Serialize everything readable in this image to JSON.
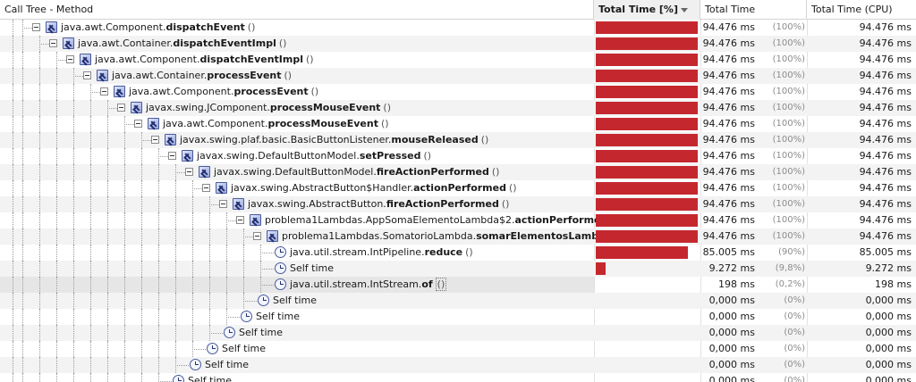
{
  "header": {
    "method": "Call Tree - Method",
    "total_time_pct": "Total Time [%]",
    "total_time": "Total Time",
    "total_time_cpu": "Total Time (CPU)"
  },
  "rows": [
    {
      "depth": 0,
      "kind": "method",
      "prefix": "java.awt.Component.",
      "name": "dispatchEvent",
      "paren": "()",
      "fraction": 1.0,
      "ms": "94.476 ms",
      "pct": "(100%)",
      "cpu": "94.476 ms"
    },
    {
      "depth": 1,
      "kind": "method",
      "prefix": "java.awt.Container.",
      "name": "dispatchEventImpl",
      "paren": "()",
      "fraction": 1.0,
      "ms": "94.476 ms",
      "pct": "(100%)",
      "cpu": "94.476 ms"
    },
    {
      "depth": 2,
      "kind": "method",
      "prefix": "java.awt.Component.",
      "name": "dispatchEventImpl",
      "paren": "()",
      "fraction": 1.0,
      "ms": "94.476 ms",
      "pct": "(100%)",
      "cpu": "94.476 ms"
    },
    {
      "depth": 3,
      "kind": "method",
      "prefix": "java.awt.Container.",
      "name": "processEvent",
      "paren": "()",
      "fraction": 1.0,
      "ms": "94.476 ms",
      "pct": "(100%)",
      "cpu": "94.476 ms"
    },
    {
      "depth": 4,
      "kind": "method",
      "prefix": "java.awt.Component.",
      "name": "processEvent",
      "paren": "()",
      "fraction": 1.0,
      "ms": "94.476 ms",
      "pct": "(100%)",
      "cpu": "94.476 ms"
    },
    {
      "depth": 5,
      "kind": "method",
      "prefix": "javax.swing.JComponent.",
      "name": "processMouseEvent",
      "paren": "()",
      "fraction": 1.0,
      "ms": "94.476 ms",
      "pct": "(100%)",
      "cpu": "94.476 ms"
    },
    {
      "depth": 6,
      "kind": "method",
      "prefix": "java.awt.Component.",
      "name": "processMouseEvent",
      "paren": "()",
      "fraction": 1.0,
      "ms": "94.476 ms",
      "pct": "(100%)",
      "cpu": "94.476 ms"
    },
    {
      "depth": 7,
      "kind": "method",
      "prefix": "javax.swing.plaf.basic.BasicButtonListener.",
      "name": "mouseReleased",
      "paren": "()",
      "fraction": 1.0,
      "ms": "94.476 ms",
      "pct": "(100%)",
      "cpu": "94.476 ms"
    },
    {
      "depth": 8,
      "kind": "method",
      "prefix": "javax.swing.DefaultButtonModel.",
      "name": "setPressed",
      "paren": "()",
      "fraction": 1.0,
      "ms": "94.476 ms",
      "pct": "(100%)",
      "cpu": "94.476 ms"
    },
    {
      "depth": 9,
      "kind": "method",
      "prefix": "javax.swing.DefaultButtonModel.",
      "name": "fireActionPerformed",
      "paren": "()",
      "fraction": 1.0,
      "ms": "94.476 ms",
      "pct": "(100%)",
      "cpu": "94.476 ms"
    },
    {
      "depth": 10,
      "kind": "method",
      "prefix": "javax.swing.AbstractButton$Handler.",
      "name": "actionPerformed",
      "paren": "()",
      "fraction": 1.0,
      "ms": "94.476 ms",
      "pct": "(100%)",
      "cpu": "94.476 ms"
    },
    {
      "depth": 11,
      "kind": "method",
      "prefix": "javax.swing.AbstractButton.",
      "name": "fireActionPerformed",
      "paren": "()",
      "fraction": 1.0,
      "ms": "94.476 ms",
      "pct": "(100%)",
      "cpu": "94.476 ms"
    },
    {
      "depth": 12,
      "kind": "method",
      "prefix": "problema1Lambdas.AppSomaElementoLambda$2.",
      "name": "actionPerformed",
      "paren": "()",
      "fraction": 1.0,
      "ms": "94.476 ms",
      "pct": "(100%)",
      "cpu": "94.476 ms"
    },
    {
      "depth": 13,
      "kind": "method",
      "prefix": "problema1Lambdas.SomatorioLambda.",
      "name": "somarElementosLambdas",
      "paren": "()",
      "fraction": 1.0,
      "ms": "94.476 ms",
      "pct": "(100%)",
      "cpu": "94.476 ms"
    },
    {
      "depth": 14,
      "kind": "clock",
      "prefix": "java.util.stream.IntPipeline.",
      "name": "reduce",
      "paren": "()",
      "fraction": 0.9,
      "ms": "85.005 ms",
      "pct": "(90%)",
      "cpu": "85.005 ms"
    },
    {
      "depth": 14,
      "kind": "clock",
      "prefix": "Self time",
      "name": "",
      "paren": "",
      "fraction": 0.098,
      "ms": "9.272 ms",
      "pct": "(9,8%)",
      "cpu": "9.272 ms"
    },
    {
      "depth": 14,
      "kind": "clock",
      "prefix": "java.util.stream.IntStream.",
      "name": "of",
      "paren": "()",
      "fraction": 0.002,
      "ms": "198 ms",
      "pct": "(0,2%)",
      "cpu": "198 ms",
      "selected": true
    },
    {
      "depth": 13,
      "kind": "clock",
      "prefix": "Self time",
      "name": "",
      "paren": "",
      "fraction": 0,
      "ms": "0,000 ms",
      "pct": "(0%)",
      "cpu": "0,000 ms"
    },
    {
      "depth": 12,
      "kind": "clock",
      "prefix": "Self time",
      "name": "",
      "paren": "",
      "fraction": 0,
      "ms": "0,000 ms",
      "pct": "(0%)",
      "cpu": "0,000 ms"
    },
    {
      "depth": 11,
      "kind": "clock",
      "prefix": "Self time",
      "name": "",
      "paren": "",
      "fraction": 0,
      "ms": "0,000 ms",
      "pct": "(0%)",
      "cpu": "0,000 ms"
    },
    {
      "depth": 10,
      "kind": "clock",
      "prefix": "Self time",
      "name": "",
      "paren": "",
      "fraction": 0,
      "ms": "0,000 ms",
      "pct": "(0%)",
      "cpu": "0,000 ms"
    },
    {
      "depth": 9,
      "kind": "clock",
      "prefix": "Self time",
      "name": "",
      "paren": "",
      "fraction": 0,
      "ms": "0,000 ms",
      "pct": "(0%)",
      "cpu": "0,000 ms"
    },
    {
      "depth": 8,
      "kind": "clock",
      "prefix": "Self time",
      "name": "",
      "paren": "",
      "fraction": 0,
      "ms": "0,000 ms",
      "pct": "(0%)",
      "cpu": "0,000 ms"
    }
  ]
}
